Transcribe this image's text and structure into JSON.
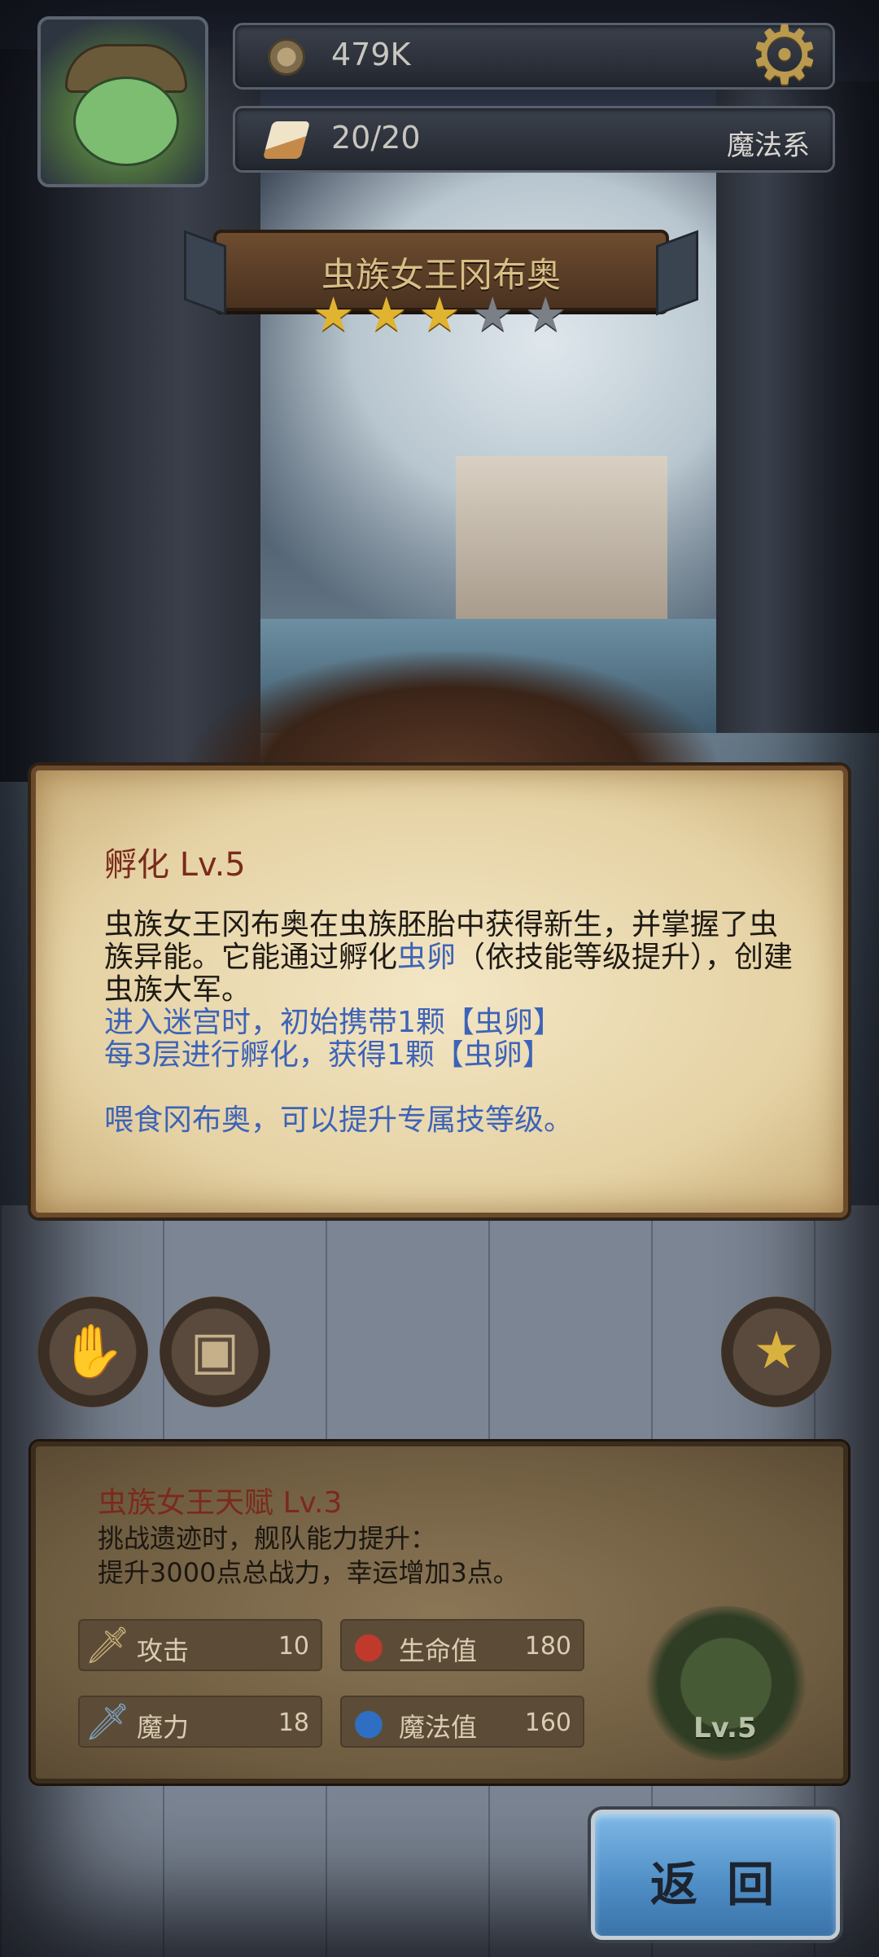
{
  "header": {
    "coins": "479K",
    "energy": "20/20",
    "class_label": "魔法系"
  },
  "hero": {
    "name": "虫族女王冈布奥",
    "stars_filled": 3,
    "stars_total": 5
  },
  "skill": {
    "title": "孵化 Lv.5",
    "desc_part1": "虫族女王冈布奥在虫族胚胎中获得新生，并掌握了虫族异能。它能通过孵化",
    "desc_link": "虫卵",
    "desc_part2": "（依技能等级提升），创建虫族大军。",
    "line_enter": "进入迷宫时，初始携带1颗【虫卵】",
    "line_hatch": "每3层进行孵化，获得1颗【虫卵】",
    "line_feed": "喂食冈布奥，可以提升专属技等级。"
  },
  "talent": {
    "title": "虫族女王天赋 Lv.3",
    "desc_line1": "挑战遗迹时，舰队能力提升：",
    "desc_line2": "提升3000点总战力，幸运增加3点。",
    "stats": [
      {
        "label": "攻击",
        "value": "10",
        "icon": "sword-icon"
      },
      {
        "label": "生命值",
        "value": "180",
        "icon": "red-potion-icon"
      },
      {
        "label": "魔力",
        "value": "18",
        "icon": "magic-sword-icon"
      },
      {
        "label": "魔法值",
        "value": "160",
        "icon": "blue-potion-icon"
      }
    ],
    "pet_level": "Lv.5"
  },
  "buttons": {
    "return_label": "返 回"
  },
  "colors": {
    "skill_title": "#7a2a1c",
    "link_blue": "#3d63b8",
    "star_on": "#e0b431",
    "star_off": "#7b7f86"
  }
}
